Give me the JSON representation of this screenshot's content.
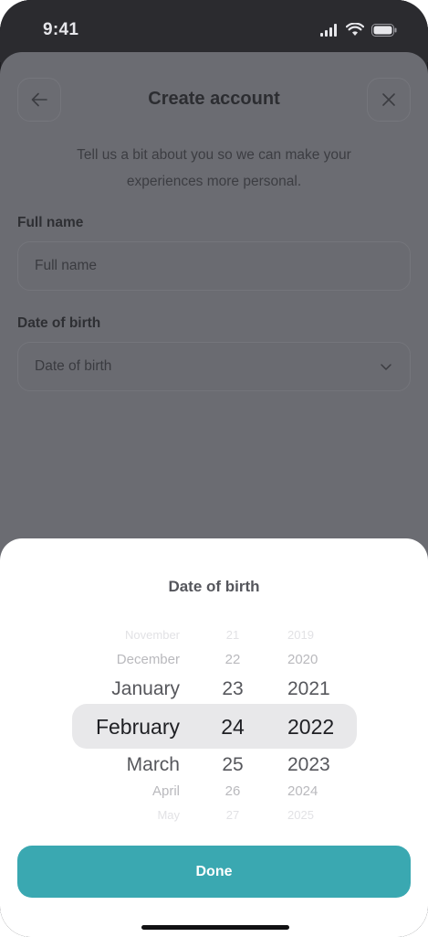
{
  "status_bar": {
    "time": "9:41"
  },
  "header": {
    "title": "Create account"
  },
  "subtitle": "Tell us a bit about you so we can make your experiences more personal.",
  "form": {
    "full_name": {
      "label": "Full name",
      "placeholder": "Full name"
    },
    "dob": {
      "label": "Date of birth",
      "placeholder": "Date of birth"
    }
  },
  "picker": {
    "title": "Date of birth",
    "months": [
      "November",
      "December",
      "January",
      "February",
      "March",
      "April",
      "May"
    ],
    "days": [
      "21",
      "22",
      "23",
      "24",
      "25",
      "26",
      "27"
    ],
    "years": [
      "2019",
      "2020",
      "2021",
      "2022",
      "2023",
      "2024",
      "2025"
    ],
    "selected": {
      "month": "February",
      "day": "24",
      "year": "2022"
    }
  },
  "done_label": "Done",
  "colors": {
    "accent": "#3aa8b1",
    "overlay": "#6b6c72",
    "selection": "#e8e8ea"
  }
}
